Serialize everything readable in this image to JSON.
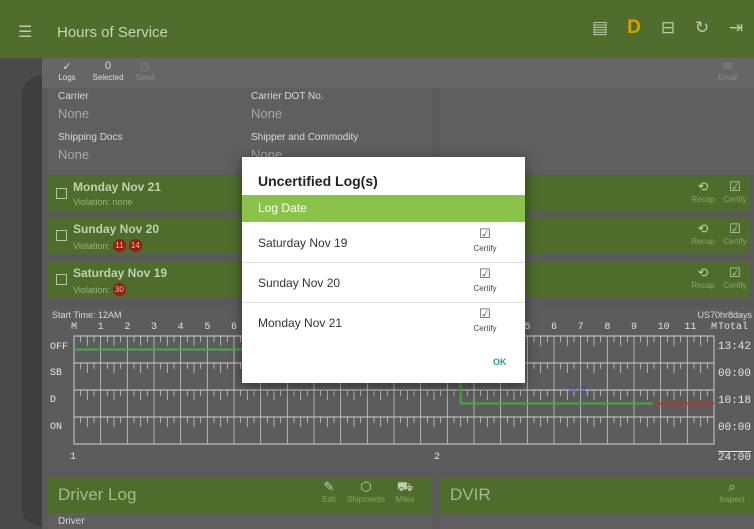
{
  "appbar": {
    "title": "Hours of Service",
    "icons": [
      "menu-icon",
      "message-icon",
      "duty-status-icon",
      "dot-inspection-icon",
      "refresh-icon",
      "logout-icon"
    ],
    "duty_letter": "D"
  },
  "toolbar": {
    "logs_label": "Logs",
    "selected_count": "0",
    "selected_label": "Selected",
    "send_label": "Send",
    "email_label": "Email"
  },
  "carrier_info": {
    "carrier_label": "Carrier",
    "carrier_value": "None",
    "dot_label": "Carrier DOT No.",
    "dot_value": "None",
    "shipping_label": "Shipping Docs",
    "shipping_value": "None",
    "shipper_label": "Shipper and Commodity",
    "shipper_value": "None"
  },
  "log_rows": [
    {
      "date": "Monday Nov 21",
      "violation_label": "Violation: none",
      "badges": []
    },
    {
      "date": "Sunday Nov 20",
      "violation_label": "Violation:",
      "badges": [
        "11",
        "14"
      ]
    },
    {
      "date": "Saturday Nov 19",
      "violation_label": "Violation:",
      "badges": [
        "30"
      ]
    }
  ],
  "row_actions": {
    "recap": "Recap",
    "certify": "Certify"
  },
  "graph": {
    "start_time": "Start Time: 12AM",
    "ruleset": "US70hr8days",
    "hours": [
      "M",
      "1",
      "2",
      "3",
      "4",
      "5",
      "6",
      "7",
      "8",
      "9",
      "10",
      "11",
      "N",
      "1",
      "2",
      "3",
      "4",
      "5",
      "6",
      "7",
      "8",
      "9",
      "10",
      "11",
      "M"
    ],
    "total_label": "Total",
    "rows": [
      "OFF",
      "SB",
      "D",
      "ON"
    ],
    "totals": [
      "13:42",
      "00:00",
      "10:18",
      "00:00"
    ],
    "grand_total": "24:00",
    "marker_left": "1",
    "marker_mid": "2",
    "segment_label": "10:18"
  },
  "bottom": {
    "driver_log": "Driver Log",
    "edit": "Edit",
    "shipments": "Shipments",
    "miles": "Miles",
    "dvir": "DVIR",
    "inspect": "Inspect",
    "driver_label": "Driver"
  },
  "dialog": {
    "title": "Uncertified Log(s)",
    "header": "Log Date",
    "rows": [
      {
        "date": "Saturday Nov 19",
        "action": "Certify"
      },
      {
        "date": "Sunday Nov 20",
        "action": "Certify"
      },
      {
        "date": "Monday Nov 21",
        "action": "Certify"
      }
    ],
    "ok_label": "OK"
  },
  "colors": {
    "appbar": "#4f6e2c",
    "dialog_header": "#8bc34a",
    "ok_text": "#1aa1a1",
    "violation_badge": "#9a1d12",
    "off_duty_line": "#3fae3f",
    "driving_line": "#c0302a"
  }
}
